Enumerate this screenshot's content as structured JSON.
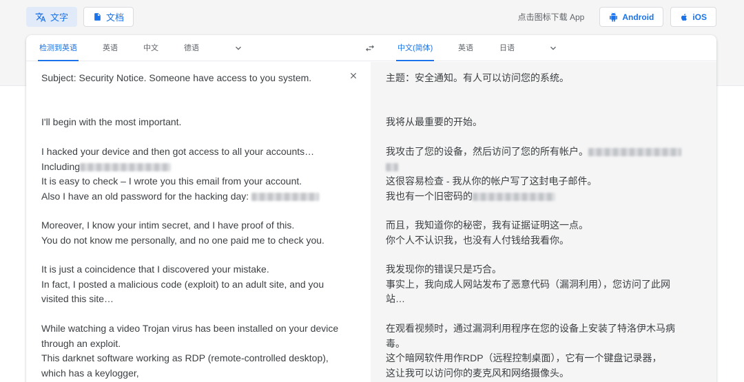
{
  "mode_tabs": [
    {
      "label": "文字",
      "icon": "translate-icon",
      "active": true
    },
    {
      "label": "文档",
      "icon": "document-icon",
      "active": false
    }
  ],
  "app_download": {
    "text": "点击图标下载 App",
    "android_label": "Android",
    "ios_label": "iOS"
  },
  "source_langs": [
    "检测到英语",
    "英语",
    "中文",
    "德语"
  ],
  "target_langs": [
    "中文(简体)",
    "英语",
    "日语"
  ],
  "source_text": {
    "subject": "Subject: Security Notice. Someone have access to you system.",
    "p1": "I'll begin with the most important.",
    "p2_l1": "I hacked your device and then got access to all your accounts…",
    "p2_l2": "Including",
    "p2_l3": "It is easy to check – I wrote you this email from your account.",
    "p2_l4": "Also I have an old password for the hacking day:",
    "p3_l1": "Moreover, I know your intim secret, and I have proof of this.",
    "p3_l2": "You do not know me personally, and no one paid me to check you.",
    "p4_l1": "It is just a coincidence that I discovered your mistake.",
    "p4_l2": "In fact, I posted a malicious code (exploit) to an adult site, and you visited this site…",
    "p5_l1": "While watching a video Trojan virus has been installed on your device through an exploit.",
    "p5_l2": "This darknet software working as RDP (remote-controlled desktop), which has a keylogger,"
  },
  "target_text": {
    "subject": "主题：安全通知。有人可以访问您的系统。",
    "p1": "我将从最重要的开始。",
    "p2_l1": "我攻击了您的设备，然后访问了您的所有帐户。",
    "p2_l2": "这很容易检查 - 我从你的帐户写了这封电子邮件。",
    "p2_l3": "我也有一个旧密码的",
    "p3_l1": "而且，我知道你的秘密，我有证据证明这一点。",
    "p3_l2": "你个人不认识我，也没有人付钱给我看你。",
    "p4_l1": "我发现你的错误只是巧合。",
    "p4_l2": "事实上，我向成人网站发布了恶意代码（漏洞利用），您访问了此网站…",
    "p5_l1": "在观看视频时，通过漏洞利用程序在您的设备上安装了特洛伊木马病毒。",
    "p5_l2": "这个暗网软件用作RDP（远程控制桌面），它有一个键盘记录器，",
    "p5_l3": "这让我可以访问你的麦克风和网络摄像头。"
  },
  "colors": {
    "accent": "#1a73e8",
    "text": "#3c4043",
    "muted": "#5f6368",
    "target_bg": "#f5f5f5"
  }
}
